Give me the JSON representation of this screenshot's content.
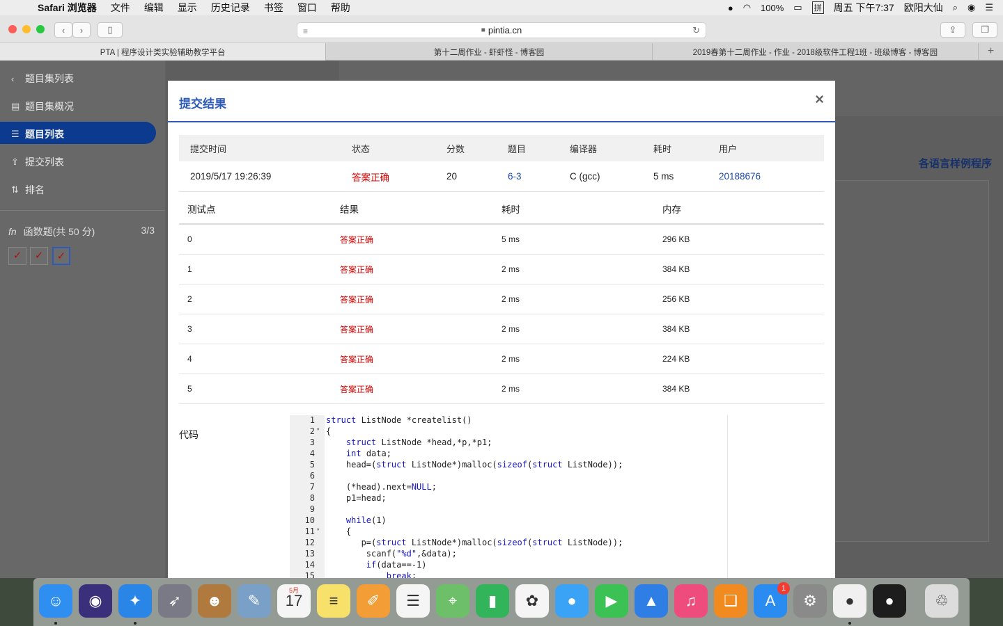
{
  "menubar": {
    "app_name": "Safari 浏览器",
    "menus": [
      "文件",
      "编辑",
      "显示",
      "历史记录",
      "书签",
      "窗口",
      "帮助"
    ],
    "battery": "100%",
    "input_method": "拼",
    "clock": "周五 下午7:37",
    "user": "欧阳大仙"
  },
  "browser": {
    "url": "pintia.cn",
    "tabs": [
      {
        "title": "PTA | 程序设计类实验辅助教学平台",
        "active": true
      },
      {
        "title": "第十二周作业 - 虾虾怪 - 博客园",
        "active": false
      },
      {
        "title": "2019春第十二周作业 - 作业 - 2018级软件工程1班 - 班级博客 - 博客园",
        "active": false
      }
    ]
  },
  "sidebar": {
    "back_label": "题目集列表",
    "items": [
      {
        "label": "题目集概况",
        "icon": "book-icon"
      },
      {
        "label": "题目列表",
        "icon": "list-icon",
        "active": true
      },
      {
        "label": "提交列表",
        "icon": "upload-icon"
      },
      {
        "label": "排名",
        "icon": "sort-icon"
      }
    ],
    "section_label": "函数题(共 50 分)",
    "section_count": "3/3",
    "checks": [
      "✓",
      "✓",
      "✓"
    ]
  },
  "main": {
    "sample_link": "各语言样例程序"
  },
  "modal": {
    "title": "提交结果",
    "close": "×",
    "summary_headers": [
      "提交时间",
      "状态",
      "分数",
      "题目",
      "编译器",
      "耗时",
      "用户"
    ],
    "summary": {
      "time": "2019/5/17 19:26:39",
      "status": "答案正确",
      "score": "20",
      "problem": "6-3",
      "compiler": "C (gcc)",
      "elapsed": "5 ms",
      "user": "20188676"
    },
    "test_headers": [
      "测试点",
      "结果",
      "耗时",
      "内存"
    ],
    "tests": [
      {
        "id": "0",
        "result": "答案正确",
        "time": "5 ms",
        "memory": "296 KB"
      },
      {
        "id": "1",
        "result": "答案正确",
        "time": "2 ms",
        "memory": "384 KB"
      },
      {
        "id": "2",
        "result": "答案正确",
        "time": "2 ms",
        "memory": "256 KB"
      },
      {
        "id": "3",
        "result": "答案正确",
        "time": "2 ms",
        "memory": "384 KB"
      },
      {
        "id": "4",
        "result": "答案正确",
        "time": "2 ms",
        "memory": "224 KB"
      },
      {
        "id": "5",
        "result": "答案正确",
        "time": "2 ms",
        "memory": "384 KB"
      }
    ],
    "code_label": "代码",
    "code_lines": [
      {
        "n": "1",
        "text": "struct ListNode *createlist()"
      },
      {
        "n": "2",
        "text": "{",
        "fold": true
      },
      {
        "n": "3",
        "text": "    struct ListNode *head,*p,*p1;"
      },
      {
        "n": "4",
        "text": "    int data;"
      },
      {
        "n": "5",
        "text": "    head=(struct ListNode*)malloc(sizeof(struct ListNode));"
      },
      {
        "n": "6",
        "text": ""
      },
      {
        "n": "7",
        "text": "    (*head).next=NULL;"
      },
      {
        "n": "8",
        "text": "    p1=head;"
      },
      {
        "n": "9",
        "text": ""
      },
      {
        "n": "10",
        "text": "    while(1)"
      },
      {
        "n": "11",
        "text": "    {",
        "fold": true
      },
      {
        "n": "12",
        "text": "       p=(struct ListNode*)malloc(sizeof(struct ListNode));"
      },
      {
        "n": "13",
        "text": "        scanf(\"%d\",&data);"
      },
      {
        "n": "14",
        "text": "        if(data==-1)"
      },
      {
        "n": "15",
        "text": "            break;"
      }
    ]
  },
  "dock": {
    "apps": [
      {
        "name": "finder-icon",
        "glyph": "☺",
        "color": "#2f8ff0",
        "running": true
      },
      {
        "name": "siri-icon",
        "glyph": "◉",
        "color": "#3a2f7a"
      },
      {
        "name": "safari-icon",
        "glyph": "✦",
        "color": "#2a86e6",
        "running": true
      },
      {
        "name": "launchpad-icon",
        "glyph": "➶",
        "color": "#7a7a86"
      },
      {
        "name": "contacts-icon",
        "glyph": "☻",
        "color": "#b07a3e"
      },
      {
        "name": "preview-icon",
        "glyph": "✎",
        "color": "#7aa0c8"
      },
      {
        "name": "calendar-icon",
        "glyph": "17",
        "color": "#f5f5f5",
        "label": "5月"
      },
      {
        "name": "notes-icon",
        "glyph": "≡",
        "color": "#f7e16b"
      },
      {
        "name": "pages-icon",
        "glyph": "✐",
        "color": "#f29d35"
      },
      {
        "name": "reminders-icon",
        "glyph": "☰",
        "color": "#f5f5f5"
      },
      {
        "name": "maps-icon",
        "glyph": "⌖",
        "color": "#6dbf6a"
      },
      {
        "name": "numbers-icon",
        "glyph": "▮",
        "color": "#32b45b"
      },
      {
        "name": "photos-icon",
        "glyph": "✿",
        "color": "#f5f5f5"
      },
      {
        "name": "messages-icon",
        "glyph": "●",
        "color": "#3aa3f5"
      },
      {
        "name": "facetime-icon",
        "glyph": "▶",
        "color": "#3cc254"
      },
      {
        "name": "keynote-icon",
        "glyph": "▲",
        "color": "#2f7ee5"
      },
      {
        "name": "itunes-icon",
        "glyph": "♫",
        "color": "#ef4c7e"
      },
      {
        "name": "books-icon",
        "glyph": "❑",
        "color": "#f18a1f"
      },
      {
        "name": "appstore-icon",
        "glyph": "A",
        "color": "#2a8cf0",
        "badge": "1"
      },
      {
        "name": "system-preferences-icon",
        "glyph": "⚙",
        "color": "#8a8a8a"
      },
      {
        "name": "wechat-icon",
        "glyph": "●",
        "color": "#f0f0f0",
        "running": true
      },
      {
        "name": "qq-icon",
        "glyph": "●",
        "color": "#1d1d1d"
      },
      {
        "name": "trash-icon",
        "glyph": "♲",
        "color": "#dcdcdc"
      }
    ]
  }
}
